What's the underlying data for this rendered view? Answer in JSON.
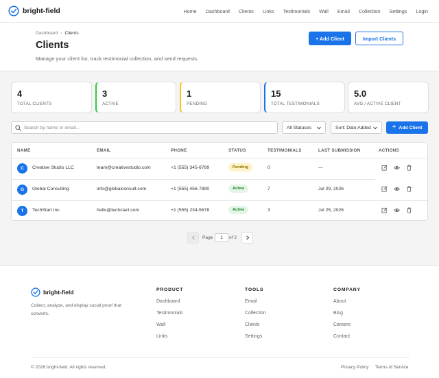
{
  "brand": {
    "name": "bright-field",
    "accent": "#1a73e8"
  },
  "nav": {
    "items": [
      "Home",
      "Dashboard",
      "Clients",
      "Links",
      "Testimonials",
      "Wall",
      "Email",
      "Collection",
      "Settings",
      "Login"
    ]
  },
  "header": {
    "breadcrumb": [
      "Dashboard",
      "Clients"
    ],
    "title": "Clients",
    "subtitle": "Manage your client list, track testimonial collection, and send requests.",
    "add_button": "+ Add Client",
    "import_button": "Import Clients"
  },
  "stats": [
    {
      "value": "4",
      "label": "TOTAL CLIENTS"
    },
    {
      "value": "3",
      "label": "ACTIVE",
      "color": "#2ecc40"
    },
    {
      "value": "1",
      "label": "PENDING",
      "color": "#f5c518"
    },
    {
      "value": "15",
      "label": "TOTAL TESTIMONIALS",
      "color": "#1a73e8"
    },
    {
      "value": "5.0",
      "label": "AVG / ACTIVE CLIENT"
    }
  ],
  "filters": {
    "search_placeholder": "Search by name or email...",
    "status_select": "All Statuses",
    "sort_select": "Sort: Date Added",
    "add_button": "Add Client"
  },
  "table": {
    "columns": [
      "NAME",
      "EMAIL",
      "PHONE",
      "STATUS",
      "TESTIMONIALS",
      "LAST SUBMISSION",
      "ACTIONS"
    ],
    "rows": [
      {
        "initial": "C",
        "name": "Creative Studio LLC",
        "email": "team@creativestudio.com",
        "phone": "+1 (555) 345-6789",
        "status": "Pending",
        "testimonials": "0",
        "last_submission": "—"
      },
      {
        "initial": "G",
        "name": "Global Consulting",
        "email": "info@globalconsult.com",
        "phone": "+1 (555) 456-7890",
        "status": "Active",
        "testimonials": "7",
        "last_submission": "Jul 29, 2026"
      },
      {
        "initial": "T",
        "name": "TechStart Inc.",
        "email": "hello@techstart.com",
        "phone": "+1 (555) 234-5678",
        "status": "Active",
        "testimonials": "3",
        "last_submission": "Jul 25, 2026"
      }
    ],
    "action_icons": [
      "edit-icon",
      "eye-icon",
      "trash-icon"
    ]
  },
  "pagination": {
    "page_label": "Page",
    "current": "1",
    "of_label": "of 2"
  },
  "footer": {
    "brand": "bright-field",
    "description": "Collect, analyze, and display social proof that converts.",
    "columns": [
      {
        "heading": "PRODUCT",
        "links": [
          "Dashboard",
          "Testimonials",
          "Wall",
          "Links"
        ]
      },
      {
        "heading": "TOOLS",
        "links": [
          "Email",
          "Collection",
          "Clients",
          "Settings"
        ]
      },
      {
        "heading": "COMPANY",
        "links": [
          "About",
          "Blog",
          "Careers",
          "Contact"
        ]
      }
    ],
    "copyright": "© 2026 bright-field. All rights reserved.",
    "bottom_links": [
      "Privacy Policy",
      "Terms of Service"
    ]
  }
}
